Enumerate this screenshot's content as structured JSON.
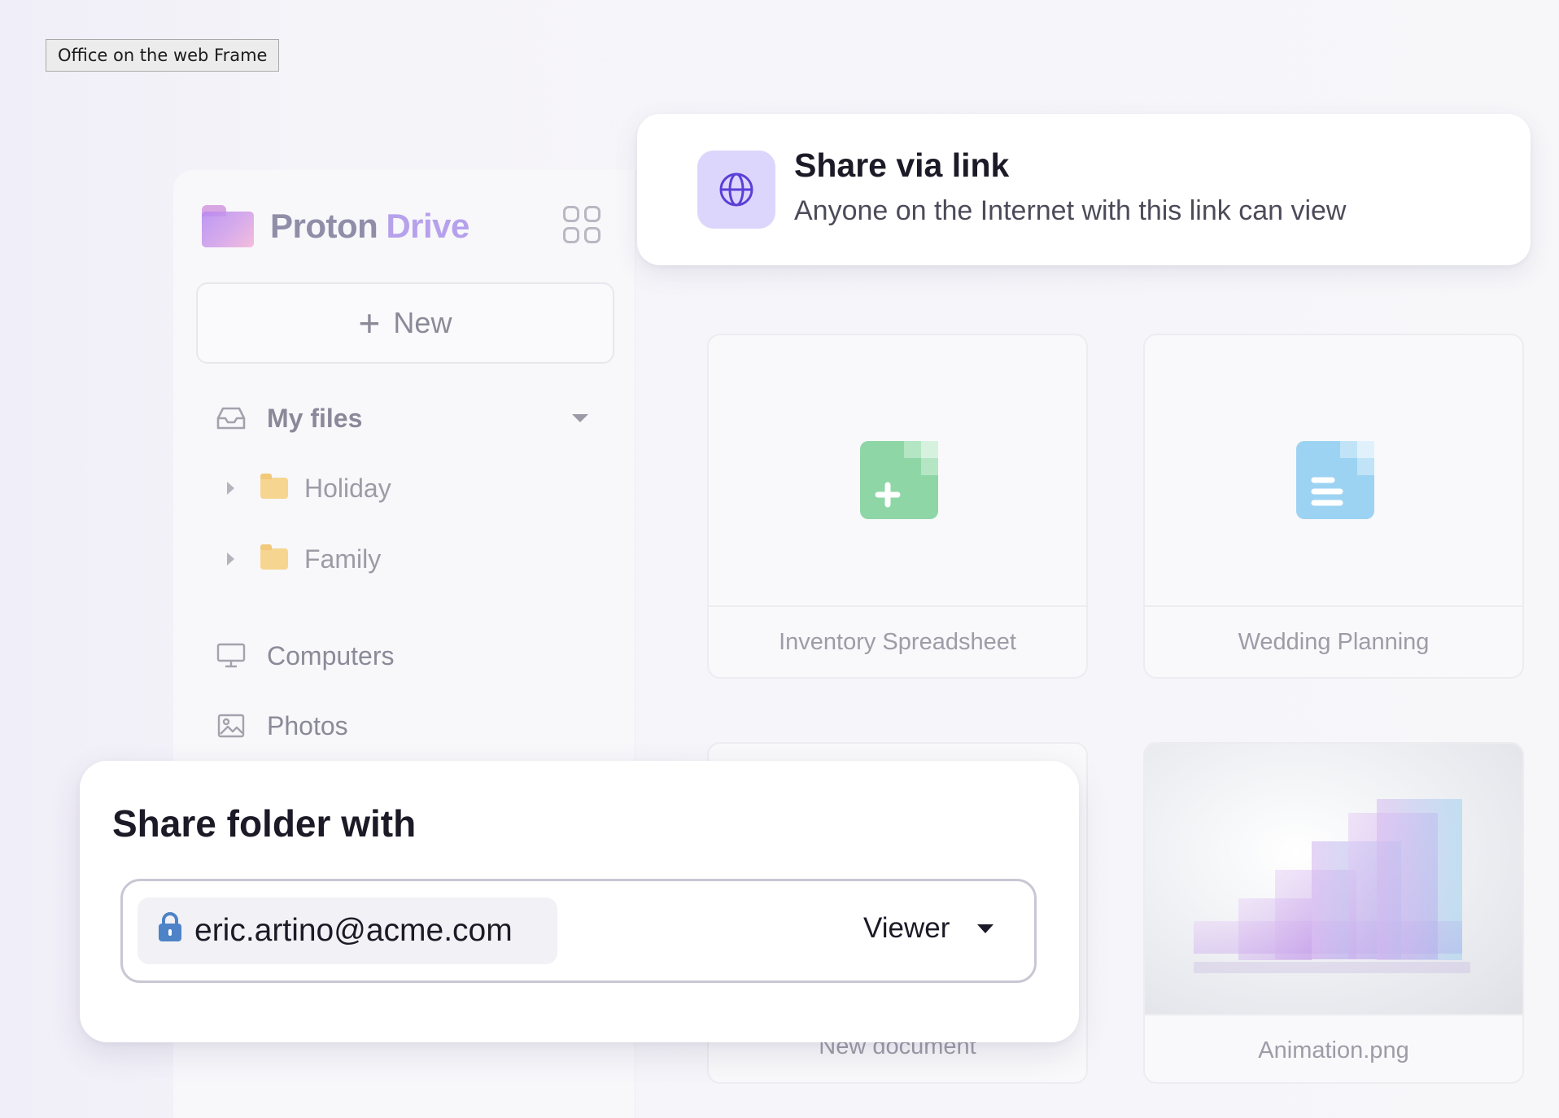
{
  "frame_label": "Office on the web Frame",
  "sidebar": {
    "brand_part1": "Proton",
    "brand_part2": "Drive",
    "new_button_label": "New",
    "my_files_label": "My files",
    "folders": [
      {
        "label": "Holiday"
      },
      {
        "label": "Family"
      }
    ],
    "computers_label": "Computers",
    "photos_label": "Photos"
  },
  "share_link": {
    "title": "Share via link",
    "subtitle": "Anyone on the Internet with this link can view",
    "icon": "globe-icon"
  },
  "files": [
    {
      "name": "Inventory Spreadsheet",
      "icon": "spreadsheet-icon",
      "color": "#8fd6a6"
    },
    {
      "name": "Wedding Planning",
      "icon": "document-icon",
      "color": "#9dd3f2"
    },
    {
      "name": "New document",
      "icon": "document-icon"
    },
    {
      "name": "Animation.png",
      "icon": "image-preview"
    }
  ],
  "share_folder": {
    "title": "Share folder with",
    "email": "eric.artino@acme.com",
    "role": "Viewer"
  },
  "colors": {
    "accent": "#6d4aff",
    "globe_bg": "#ddd6fc",
    "lock": "#4e83c7"
  }
}
